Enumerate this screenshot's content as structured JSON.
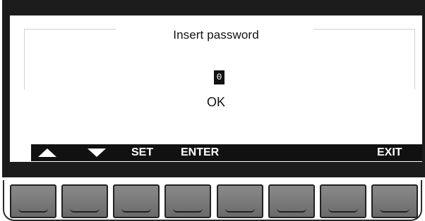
{
  "screen": {
    "title": "Insert password",
    "password_digit": "0",
    "confirm_label": "OK"
  },
  "softkeys": {
    "up_icon": "triangle-up-icon",
    "down_icon": "triangle-down-icon",
    "set": "SET",
    "enter": "ENTER",
    "exit": "EXIT"
  },
  "colors": {
    "bezel": "#1c1c1c",
    "display": "#ffffff",
    "softbar": "#111111",
    "key": "#7a7a7a"
  },
  "hardware_keys": [
    "key-1",
    "key-2",
    "key-3",
    "key-4",
    "key-5",
    "key-6",
    "key-7",
    "key-8"
  ]
}
